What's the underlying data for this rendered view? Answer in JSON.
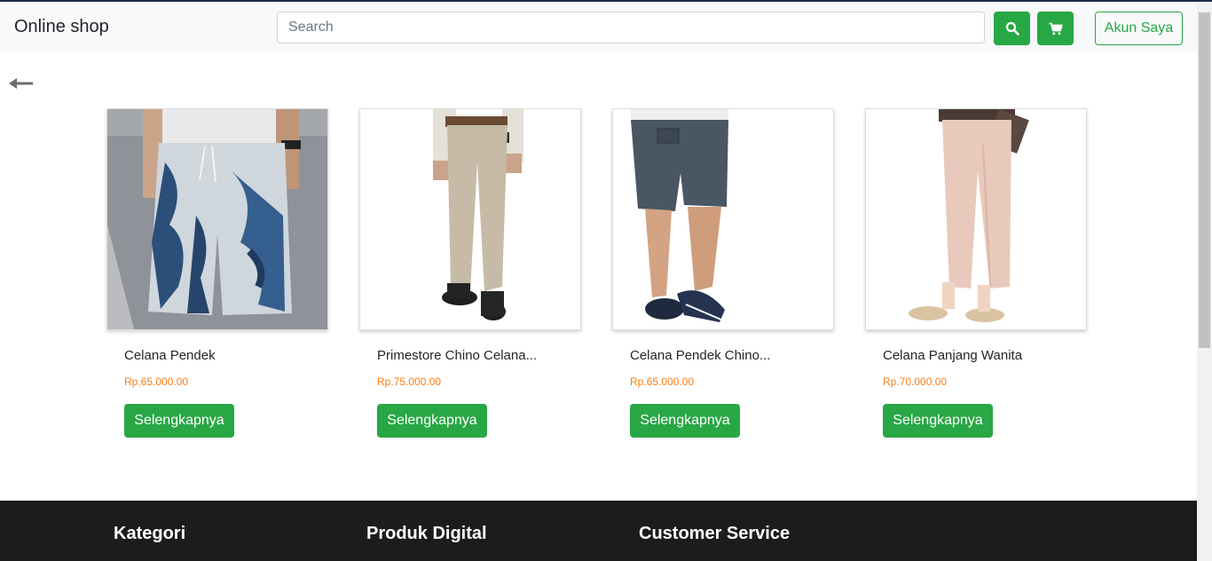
{
  "navbar": {
    "brand": "Online shop",
    "search_placeholder": "Search",
    "account_label": "Akun Saya"
  },
  "products": [
    {
      "title": "Celana Pendek",
      "price": "Rp.65.000.00",
      "button": "Selengkapnya"
    },
    {
      "title": "Primestore Chino Celana...",
      "price": "Rp.75.000.00",
      "button": "Selengkapnya"
    },
    {
      "title": "Celana Pendek Chino...",
      "price": "Rp.65.000.00",
      "button": "Selengkapnya"
    },
    {
      "title": "Celana Panjang Wanita",
      "price": "Rp.70.000.00",
      "button": "Selengkapnya"
    }
  ],
  "footer": {
    "headings": [
      "Kategori",
      "Produk Digital",
      "Customer Service"
    ]
  },
  "colors": {
    "accent": "#28a745",
    "price": "#fd7e14",
    "footer_bg": "#1c1c1c"
  },
  "icons": [
    "search-icon",
    "cart-icon",
    "back-arrow-icon"
  ]
}
